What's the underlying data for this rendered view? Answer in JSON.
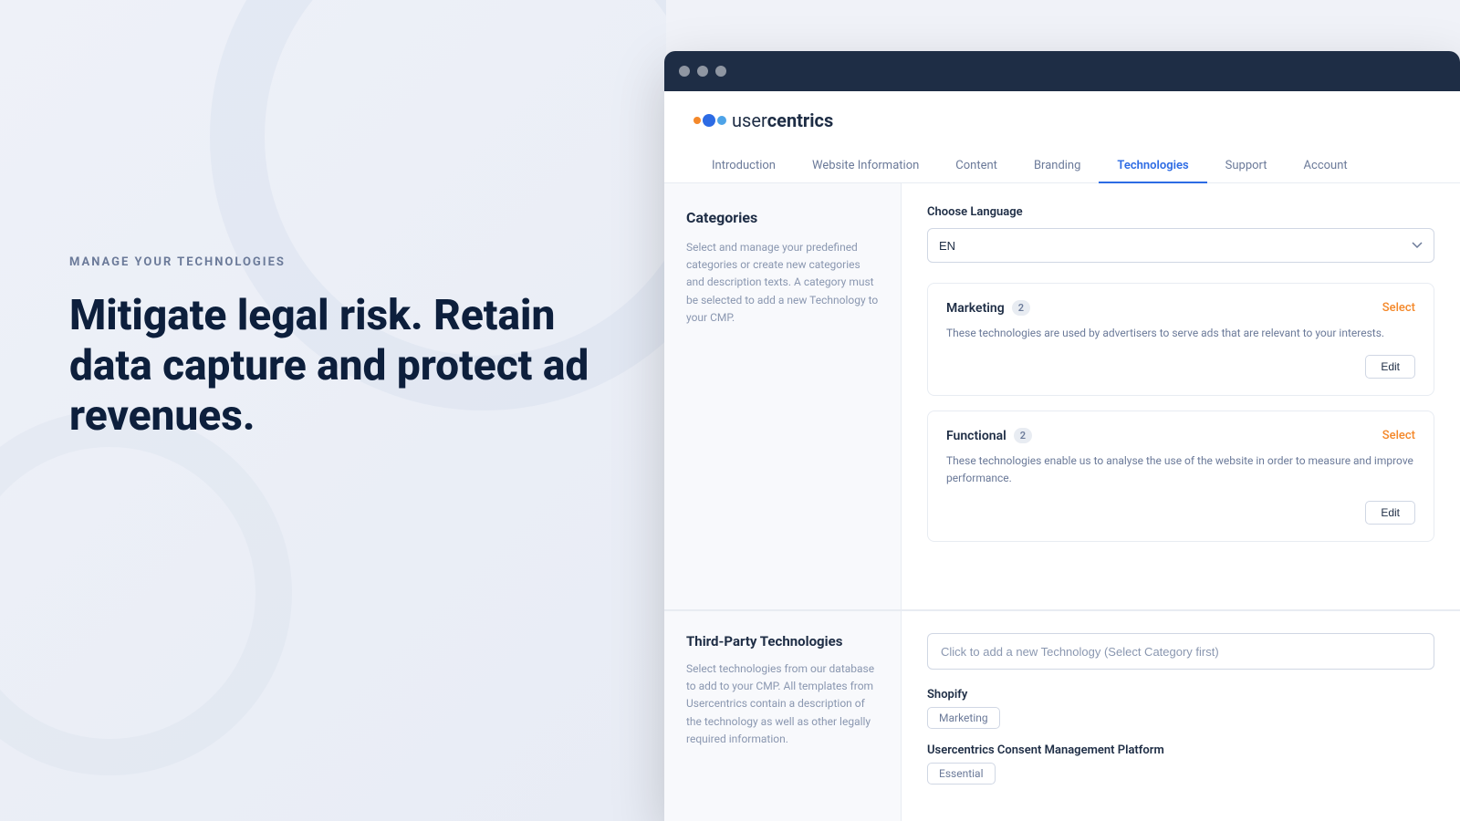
{
  "left": {
    "subtitle": "MANAGE YOUR TECHNOLOGIES",
    "headline": "Mitigate legal risk. Retain data capture and protect ad revenues."
  },
  "browser": {
    "logo_text_light": "user",
    "logo_text_bold": "centrics",
    "nav": {
      "tabs": [
        {
          "label": "Introduction",
          "active": false
        },
        {
          "label": "Website Information",
          "active": false
        },
        {
          "label": "Content",
          "active": false
        },
        {
          "label": "Branding",
          "active": false
        },
        {
          "label": "Technologies",
          "active": true
        },
        {
          "label": "Support",
          "active": false
        },
        {
          "label": "Account",
          "active": false
        }
      ]
    },
    "categories_panel": {
      "title": "Categories",
      "description": "Select and manage your predefined categories or create new categories and description texts. A category must be selected to add a new Technology to your CMP."
    },
    "right_panel": {
      "choose_language_label": "Choose Language",
      "language_value": "EN",
      "categories": [
        {
          "name": "Marketing",
          "badge": "2",
          "select_label": "Select",
          "description": "These technologies are used by advertisers to serve ads that are relevant to your interests.",
          "edit_label": "Edit"
        },
        {
          "name": "Functional",
          "badge": "2",
          "select_label": "Select",
          "description": "These technologies enable us to analyse the use of the website in order to measure and improve performance.",
          "edit_label": "Edit"
        }
      ]
    },
    "third_party": {
      "title": "Third-Party Technologies",
      "description": "Select technologies from our database to add to your CMP. All templates from Usercentrics contain a description of the technology as well as other legally required information."
    },
    "third_party_right": {
      "add_tech_placeholder": "Click to add a new Technology (Select Category first)",
      "technologies": [
        {
          "name": "Shopify",
          "tag": "Marketing"
        },
        {
          "name": "Usercentrics Consent Management Platform",
          "tag": "Essential"
        }
      ]
    }
  }
}
